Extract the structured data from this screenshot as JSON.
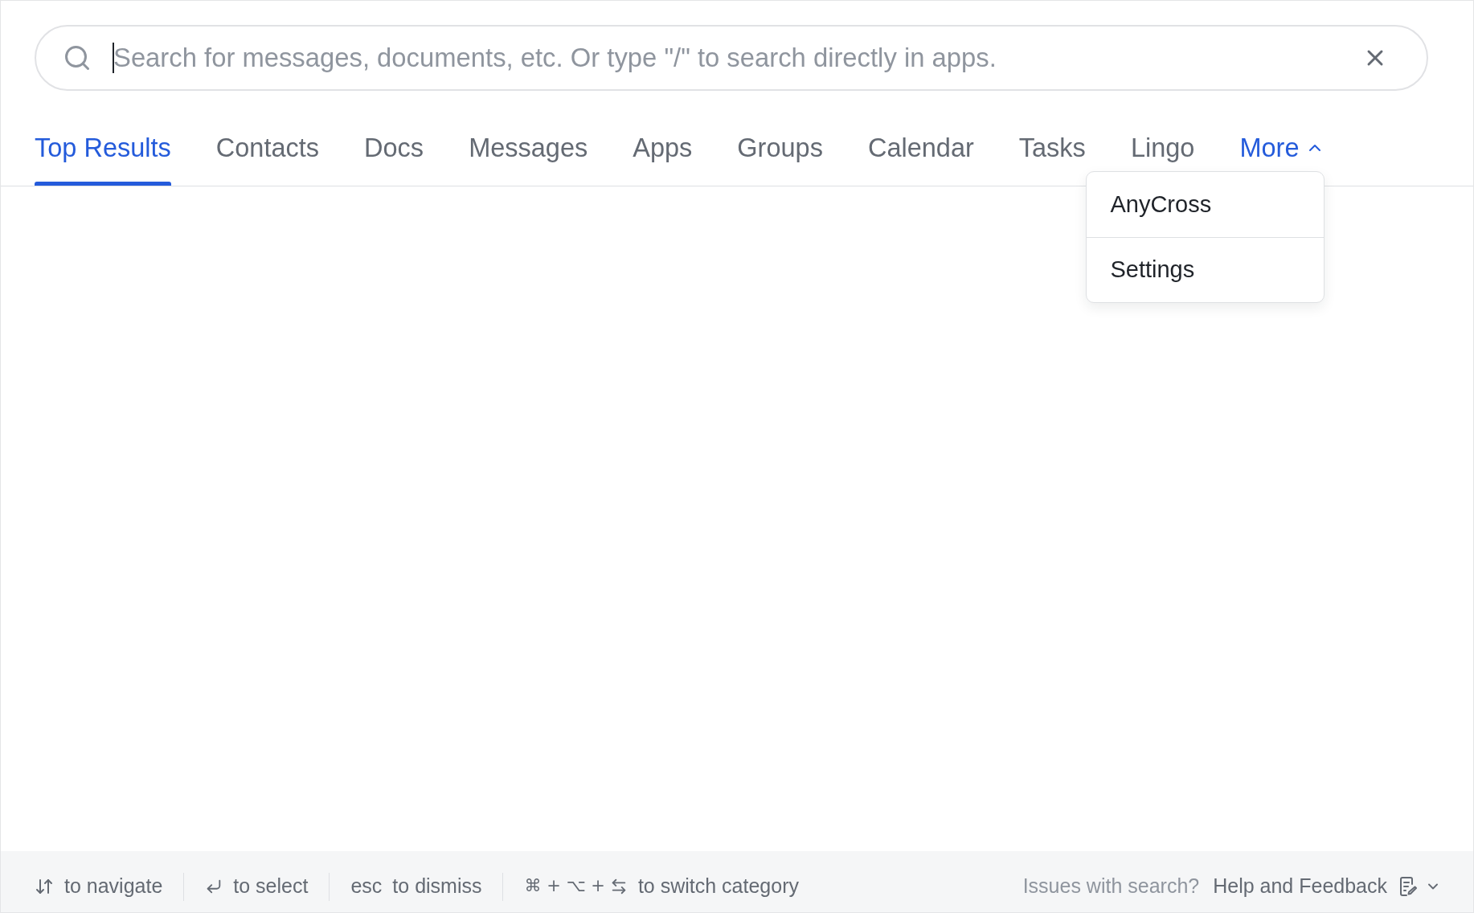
{
  "search": {
    "placeholder": "Search for messages, documents, etc. Or type \"/\" to search directly in apps.",
    "focused": true
  },
  "tabs": [
    {
      "label": "Top Results",
      "selected": true
    },
    {
      "label": "Contacts",
      "selected": false
    },
    {
      "label": "Docs",
      "selected": false
    },
    {
      "label": "Messages",
      "selected": false
    },
    {
      "label": "Apps",
      "selected": false
    },
    {
      "label": "Groups",
      "selected": false
    },
    {
      "label": "Calendar",
      "selected": false
    },
    {
      "label": "Tasks",
      "selected": false
    },
    {
      "label": "Lingo",
      "selected": false
    }
  ],
  "more": {
    "label": "More",
    "expanded": true,
    "menu": [
      {
        "label": "AnyCross"
      },
      {
        "label": "Settings"
      }
    ]
  },
  "footer": {
    "hints": [
      {
        "kind": "navigate",
        "label": "to navigate"
      },
      {
        "kind": "select",
        "label": "to select"
      },
      {
        "kind": "dismiss",
        "key": "esc",
        "label": "to dismiss"
      },
      {
        "kind": "switch",
        "key": "⌘ + ⌥ +",
        "label": "to switch category"
      }
    ],
    "issues_text": "Issues with search?",
    "help_link": "Help and Feedback"
  }
}
